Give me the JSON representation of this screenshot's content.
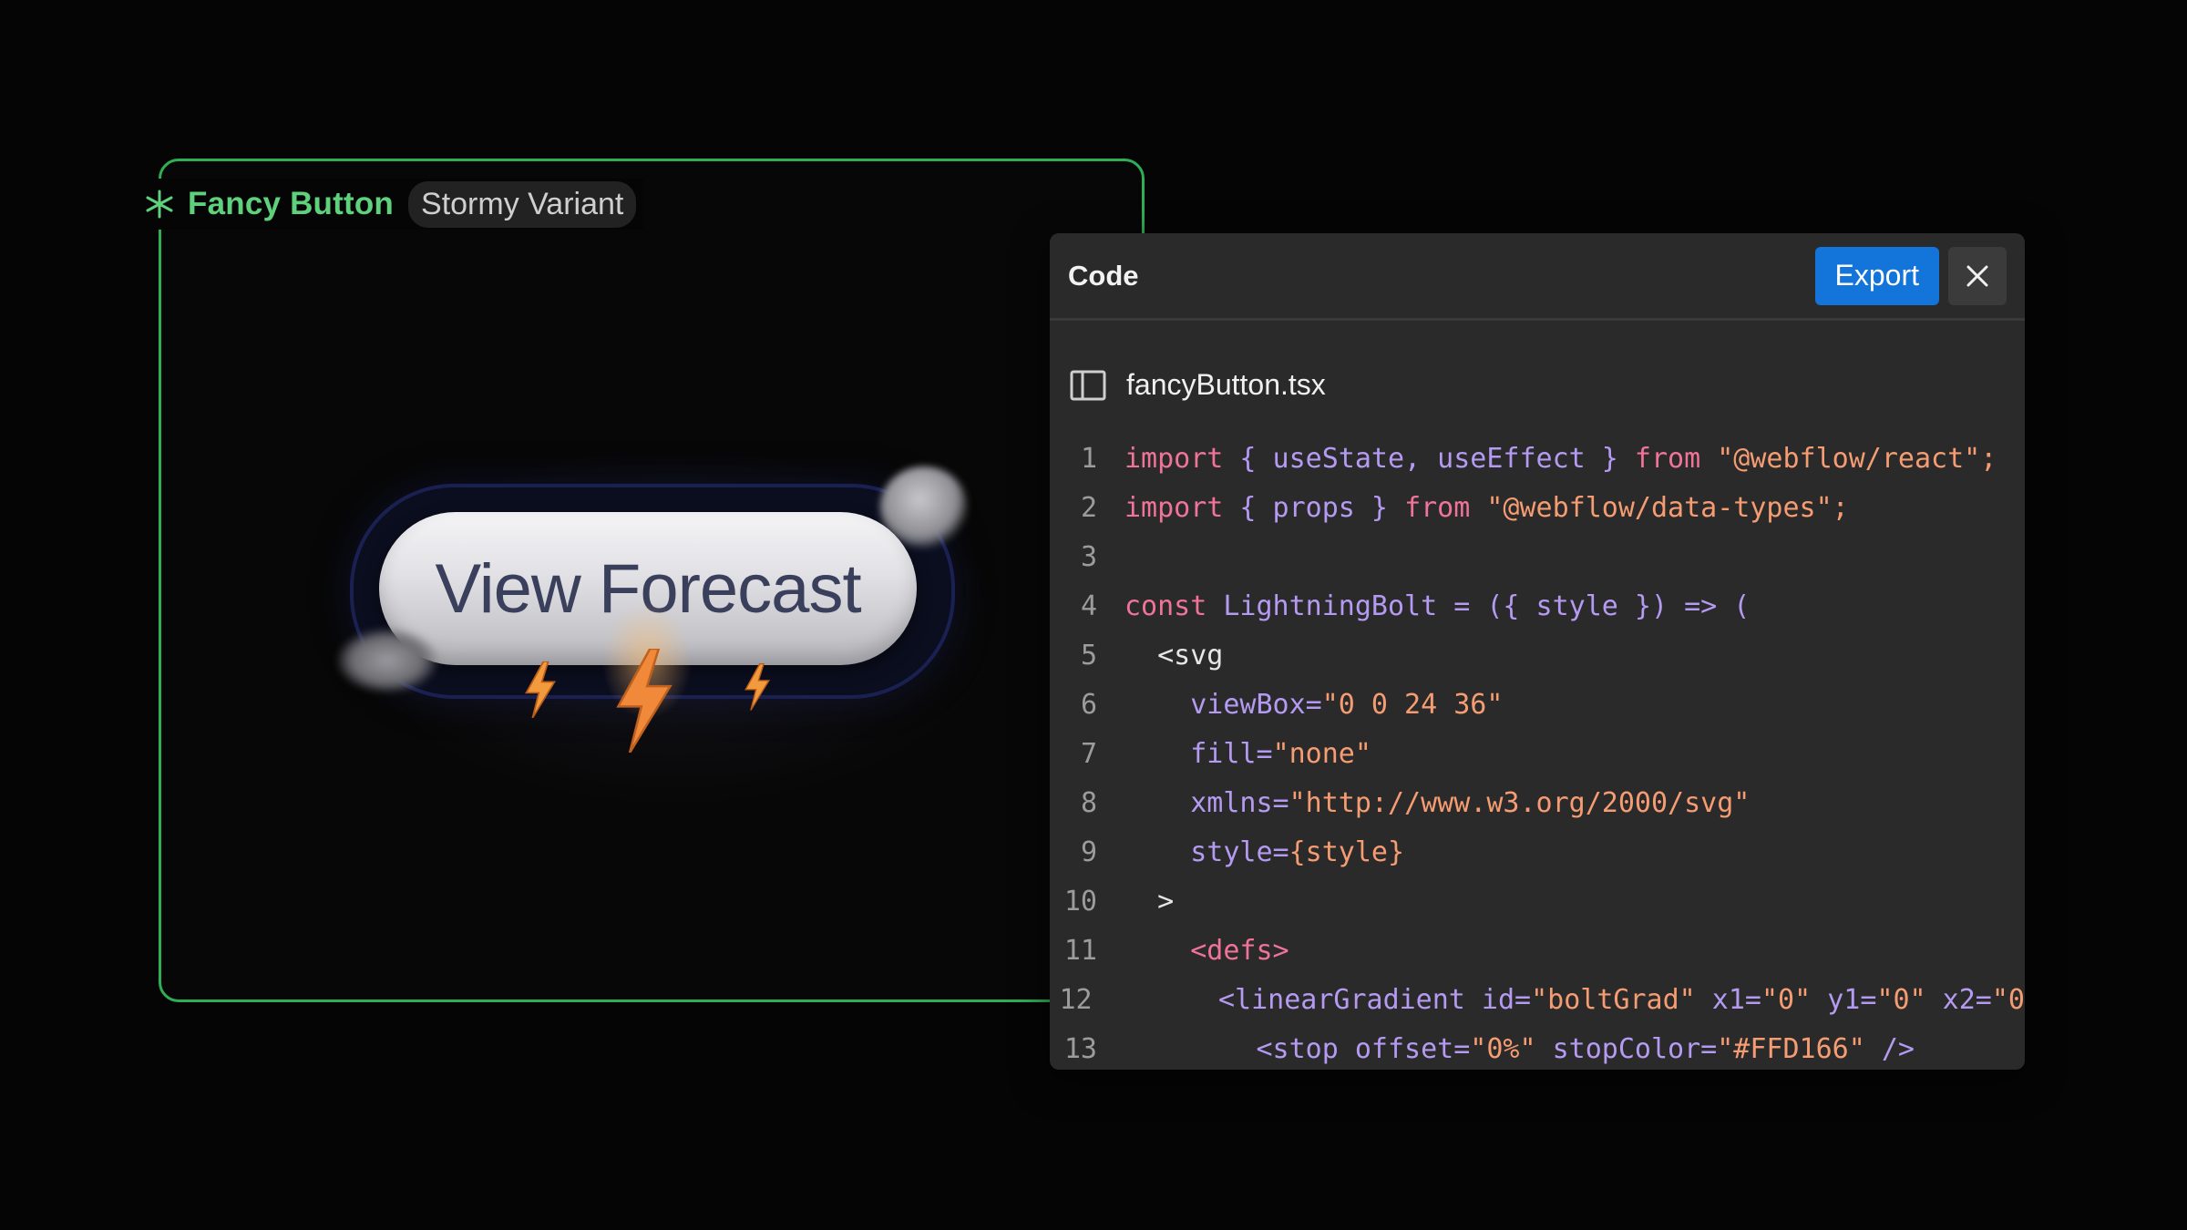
{
  "component": {
    "name": "Fancy Button",
    "variant": "Stormy Variant",
    "button_label": "View Forecast"
  },
  "panel": {
    "title": "Code",
    "export_label": "Export",
    "file_name": "fancyButton.tsx"
  },
  "code": {
    "lines": [
      {
        "n": "1",
        "t": [
          [
            "kw",
            "import"
          ],
          [
            "pn",
            " { useState, useEffect } "
          ],
          [
            "kw",
            "from"
          ],
          [
            "st",
            " \"@webflow/react\";"
          ]
        ]
      },
      {
        "n": "2",
        "t": [
          [
            "kw",
            "import"
          ],
          [
            "pn",
            " { props } "
          ],
          [
            "kw",
            "from"
          ],
          [
            "st",
            " \"@webflow/data-types\";"
          ]
        ]
      },
      {
        "n": "3",
        "t": []
      },
      {
        "n": "4",
        "t": [
          [
            "kw",
            "const"
          ],
          [
            "pn",
            " LightningBolt = ({ style }) => ("
          ]
        ]
      },
      {
        "n": "5",
        "t": [
          [
            "tx",
            "  <svg"
          ]
        ]
      },
      {
        "n": "6",
        "t": [
          [
            "at",
            "    viewBox="
          ],
          [
            "st",
            "\"0 0 24 36\""
          ]
        ]
      },
      {
        "n": "7",
        "t": [
          [
            "at",
            "    fill="
          ],
          [
            "st",
            "\"none\""
          ]
        ]
      },
      {
        "n": "8",
        "t": [
          [
            "at",
            "    xmlns="
          ],
          [
            "st",
            "\"http://www.w3.org/2000/svg\""
          ]
        ]
      },
      {
        "n": "9",
        "t": [
          [
            "at",
            "    style="
          ],
          [
            "st",
            "{style}"
          ]
        ]
      },
      {
        "n": "10",
        "t": [
          [
            "tx",
            "  >"
          ]
        ]
      },
      {
        "n": "11",
        "t": [
          [
            "kw",
            "    <defs>"
          ]
        ]
      },
      {
        "n": "12",
        "t": [
          [
            "at",
            "      <linearGradient id="
          ],
          [
            "st",
            "\"boltGrad\""
          ],
          [
            "at",
            " x1="
          ],
          [
            "st",
            "\"0\""
          ],
          [
            "at",
            " y1="
          ],
          [
            "st",
            "\"0\""
          ],
          [
            "at",
            " x2="
          ],
          [
            "st",
            "\"0"
          ]
        ]
      },
      {
        "n": "13",
        "t": [
          [
            "at",
            "        <stop offset="
          ],
          [
            "st",
            "\"0%\""
          ],
          [
            "at",
            " stopColor="
          ],
          [
            "st",
            "\"#FFD166\""
          ],
          [
            "at",
            " />"
          ]
        ]
      }
    ]
  },
  "colors": {
    "frame_border": "#2fae55",
    "accent_blue": "#1374d9",
    "keyword": "#f0739a",
    "string": "#f59c72",
    "identifier": "#b59af2"
  },
  "icons": [
    "asterisk-icon",
    "close-icon",
    "sidebar-toggle-icon",
    "lightning-bolt-icon",
    "cloud-icon"
  ]
}
